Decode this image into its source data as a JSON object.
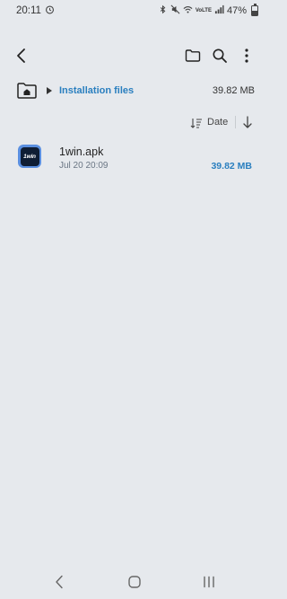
{
  "status_bar": {
    "time": "20:11",
    "network_label": "VoLTE",
    "battery": "47%",
    "battery_level": 0.47
  },
  "toolbar": {
    "icons": [
      "back-icon",
      "new-folder-icon",
      "search-icon",
      "more-options-icon"
    ]
  },
  "path": {
    "label": "Installation files",
    "size": "39.82 MB"
  },
  "sort": {
    "label": "Date"
  },
  "files": [
    {
      "name": "1win.apk",
      "date": "Jul 20 20:09",
      "size": "39.82 MB",
      "icon_text": "1win"
    }
  ],
  "colors": {
    "background": "#e6e9ed",
    "accent": "#2a7fbf",
    "app_icon_border": "#5a8fe0",
    "app_icon_bg": "#0f1e34"
  }
}
